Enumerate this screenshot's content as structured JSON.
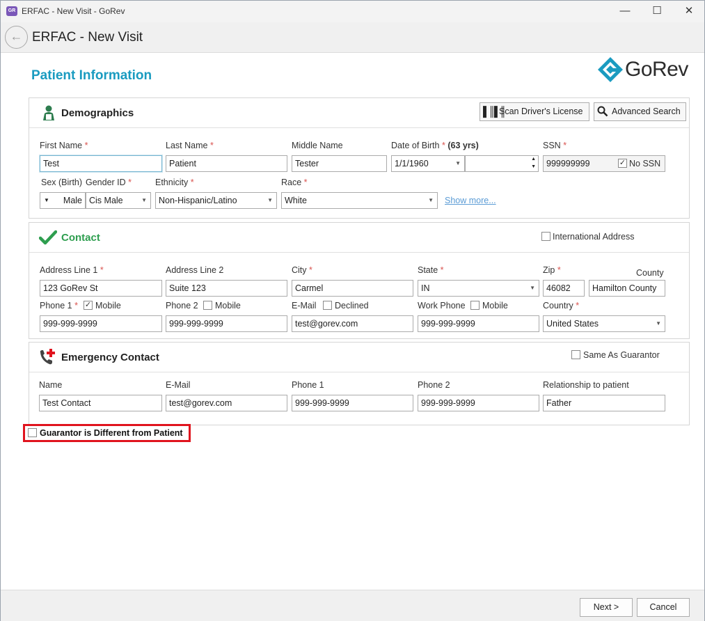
{
  "window": {
    "title": "ERFAC - New Visit - GoRev",
    "app_icon_text": "GoRev",
    "minimize": "—",
    "maximize": "☐",
    "close": "✕"
  },
  "header": {
    "back_icon": "←",
    "title": "ERFAC - New Visit"
  },
  "page": {
    "title": "Patient Information",
    "logo_text": "GoRev"
  },
  "demographics": {
    "title": "Demographics",
    "scan_button": "Scan Driver's License",
    "search_button": "Advanced Search",
    "first_name": {
      "label": "First Name",
      "value": "Test"
    },
    "last_name": {
      "label": "Last Name",
      "value": "Patient"
    },
    "middle_name": {
      "label": "Middle Name",
      "value": "Tester"
    },
    "dob": {
      "label": "Date of Birth",
      "age": "(63 yrs)",
      "value": "1/1/1960",
      "time_value": ""
    },
    "ssn": {
      "label": "SSN",
      "value": "999999999",
      "no_ssn_label": "No SSN",
      "no_ssn_checked": true
    },
    "sex": {
      "label": "Sex (Birth)",
      "value": "Male"
    },
    "gender": {
      "label": "Gender ID",
      "value": "Cis Male"
    },
    "ethnicity": {
      "label": "Ethnicity",
      "value": "Non-Hispanic/Latino"
    },
    "race": {
      "label": "Race",
      "value": "White"
    },
    "show_more": "Show more..."
  },
  "contact": {
    "title": "Contact",
    "international_label": "International Address",
    "address1": {
      "label": "Address Line 1",
      "value": "123 GoRev St"
    },
    "address2": {
      "label": "Address Line 2",
      "value": "Suite 123"
    },
    "city": {
      "label": "City",
      "value": "Carmel"
    },
    "state": {
      "label": "State",
      "value": "IN"
    },
    "zip": {
      "label": "Zip",
      "value": "46082"
    },
    "county": {
      "label": "County",
      "value": "Hamilton County"
    },
    "phone1": {
      "label": "Phone 1",
      "mobile_label": "Mobile",
      "mobile_checked": true,
      "value": "999-999-9999"
    },
    "phone2": {
      "label": "Phone 2",
      "mobile_label": "Mobile",
      "mobile_checked": false,
      "value": "999-999-9999"
    },
    "email": {
      "label": "E-Mail",
      "declined_label": "Declined",
      "value": "test@gorev.com"
    },
    "work_phone": {
      "label": "Work Phone",
      "mobile_label": "Mobile",
      "value": "999-999-9999"
    },
    "country": {
      "label": "Country",
      "value": "United States"
    }
  },
  "emergency": {
    "title": "Emergency Contact",
    "same_as_guarantor": "Same As Guarantor",
    "name": {
      "label": "Name",
      "value": "Test Contact"
    },
    "email": {
      "label": "E-Mail",
      "value": "test@gorev.com"
    },
    "phone1": {
      "label": "Phone 1",
      "value": "999-999-9999"
    },
    "phone2": {
      "label": "Phone 2",
      "value": "999-999-9999"
    },
    "relationship": {
      "label": "Relationship to patient",
      "value": "Father"
    }
  },
  "guarantor_checkbox": {
    "label": "Guarantor is Different from Patient",
    "checked": false
  },
  "footer": {
    "next": "Next >",
    "cancel": "Cancel"
  },
  "colors": {
    "accent": "#1a9bc0",
    "required": "#d9534f",
    "highlight": "#e0141e",
    "contact_check": "#2e9e4f"
  }
}
